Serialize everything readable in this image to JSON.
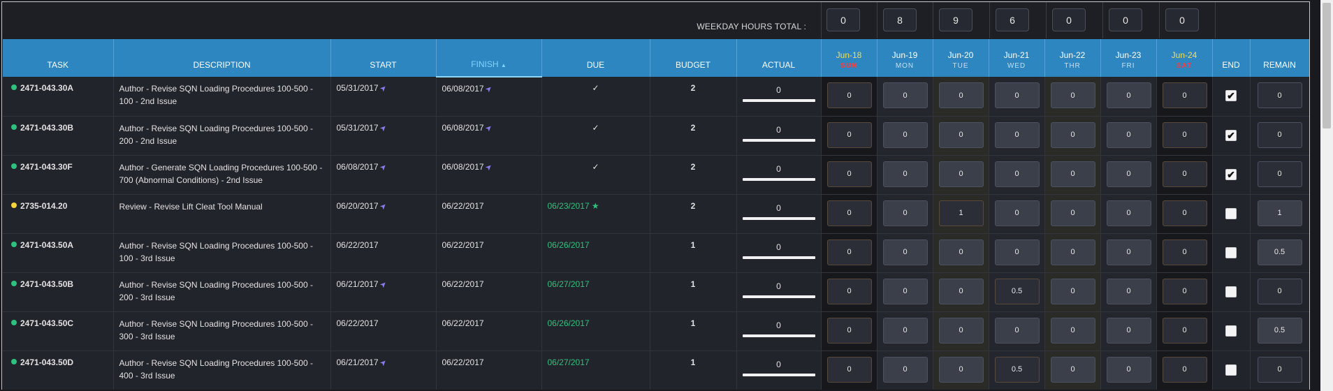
{
  "totals": {
    "label": "WEEKDAY HOURS TOTAL :",
    "values": [
      "0",
      "8",
      "9",
      "6",
      "0",
      "0",
      "0"
    ]
  },
  "columns": {
    "task": "TASK",
    "description": "DESCRIPTION",
    "start": "START",
    "finish": "FINISH",
    "due": "DUE",
    "budget": "BUDGET",
    "actual": "ACTUAL",
    "end": "END",
    "remain": "REMAIN"
  },
  "sort_icon": "caret-up-icon",
  "days": [
    {
      "date": "Jun-18",
      "name": "SUN",
      "weekend": true
    },
    {
      "date": "Jun-19",
      "name": "MON",
      "weekend": false
    },
    {
      "date": "Jun-20",
      "name": "TUE",
      "weekend": false
    },
    {
      "date": "Jun-21",
      "name": "WED",
      "weekend": false
    },
    {
      "date": "Jun-22",
      "name": "THR",
      "weekend": false
    },
    {
      "date": "Jun-23",
      "name": "FRI",
      "weekend": false
    },
    {
      "date": "Jun-24",
      "name": "SAT",
      "weekend": true
    }
  ],
  "colors": {
    "header_blue": "#2e86c1",
    "status_green": "#2ec27e",
    "status_yellow": "#f2d43a",
    "due_green": "#2ec27e",
    "weekend_red": "#ff3b3b",
    "weekend_date_yellow": "#f3df5b"
  },
  "rows": [
    {
      "task": "2471-043.30A",
      "status": "green",
      "description": "Author - Revise SQN Loading Procedures 100-500 - 100 - 2nd Issue",
      "start": "05/31/2017",
      "start_pin": true,
      "finish": "06/08/2017",
      "finish_pin": true,
      "due": "✓",
      "due_style": "check",
      "budget": "2",
      "actual": "0",
      "hours": [
        "0",
        "0",
        "0",
        "0",
        "0",
        "0",
        "0"
      ],
      "end": true,
      "remain": "0"
    },
    {
      "task": "2471-043.30B",
      "status": "green",
      "description": "Author - Revise SQN Loading Procedures 100-500 - 200 - 2nd Issue",
      "start": "05/31/2017",
      "start_pin": true,
      "finish": "06/08/2017",
      "finish_pin": true,
      "due": "✓",
      "due_style": "check",
      "budget": "2",
      "actual": "0",
      "hours": [
        "0",
        "0",
        "0",
        "0",
        "0",
        "0",
        "0"
      ],
      "end": true,
      "remain": "0"
    },
    {
      "task": "2471-043.30F",
      "status": "green",
      "description": "Author - Generate SQN Loading Procedures 100-500 - 700 (Abnormal Conditions) - 2nd Issue",
      "start": "06/08/2017",
      "start_pin": true,
      "finish": "06/08/2017",
      "finish_pin": true,
      "due": "✓",
      "due_style": "check",
      "budget": "2",
      "actual": "0",
      "hours": [
        "0",
        "0",
        "0",
        "0",
        "0",
        "0",
        "0"
      ],
      "end": true,
      "remain": "0"
    },
    {
      "task": "2735-014.20",
      "status": "yellow",
      "description": "Review - Revise Lift Cleat Tool Manual",
      "start": "06/20/2017",
      "start_pin": true,
      "finish": "06/22/2017",
      "finish_pin": false,
      "due": "06/23/2017 ★",
      "due_style": "green",
      "budget": "2",
      "actual": "0",
      "hours": [
        "0",
        "0",
        "1",
        "0",
        "0",
        "0",
        "0"
      ],
      "end": false,
      "remain": "1"
    },
    {
      "task": "2471-043.50A",
      "status": "green",
      "description": "Author - Revise SQN Loading Procedures 100-500 - 100 - 3rd Issue",
      "start": "06/22/2017",
      "start_pin": false,
      "finish": "06/22/2017",
      "finish_pin": false,
      "due": "06/26/2017",
      "due_style": "green",
      "budget": "1",
      "actual": "0",
      "hours": [
        "0",
        "0",
        "0",
        "0",
        "0",
        "0",
        "0"
      ],
      "end": false,
      "remain": "0.5"
    },
    {
      "task": "2471-043.50B",
      "status": "green",
      "description": "Author - Revise SQN Loading Procedures 100-500 - 200 - 3rd Issue",
      "start": "06/21/2017",
      "start_pin": true,
      "finish": "06/22/2017",
      "finish_pin": false,
      "due": "06/27/2017",
      "due_style": "green",
      "budget": "1",
      "actual": "0",
      "hours": [
        "0",
        "0",
        "0",
        "0.5",
        "0",
        "0",
        "0"
      ],
      "end": false,
      "remain": "0"
    },
    {
      "task": "2471-043.50C",
      "status": "green",
      "description": "Author - Revise SQN Loading Procedures 100-500 - 300 - 3rd Issue",
      "start": "06/22/2017",
      "start_pin": false,
      "finish": "06/22/2017",
      "finish_pin": false,
      "due": "06/26/2017",
      "due_style": "green",
      "budget": "1",
      "actual": "0",
      "hours": [
        "0",
        "0",
        "0",
        "0",
        "0",
        "0",
        "0"
      ],
      "end": false,
      "remain": "0.5"
    },
    {
      "task": "2471-043.50D",
      "status": "green",
      "description": "Author - Revise SQN Loading Procedures 100-500 - 400 - 3rd Issue",
      "start": "06/21/2017",
      "start_pin": true,
      "finish": "06/22/2017",
      "finish_pin": false,
      "due": "06/27/2017",
      "due_style": "green",
      "budget": "1",
      "actual": "0",
      "hours": [
        "0",
        "0",
        "0",
        "0.5",
        "0",
        "0",
        "0"
      ],
      "end": false,
      "remain": "0"
    }
  ]
}
